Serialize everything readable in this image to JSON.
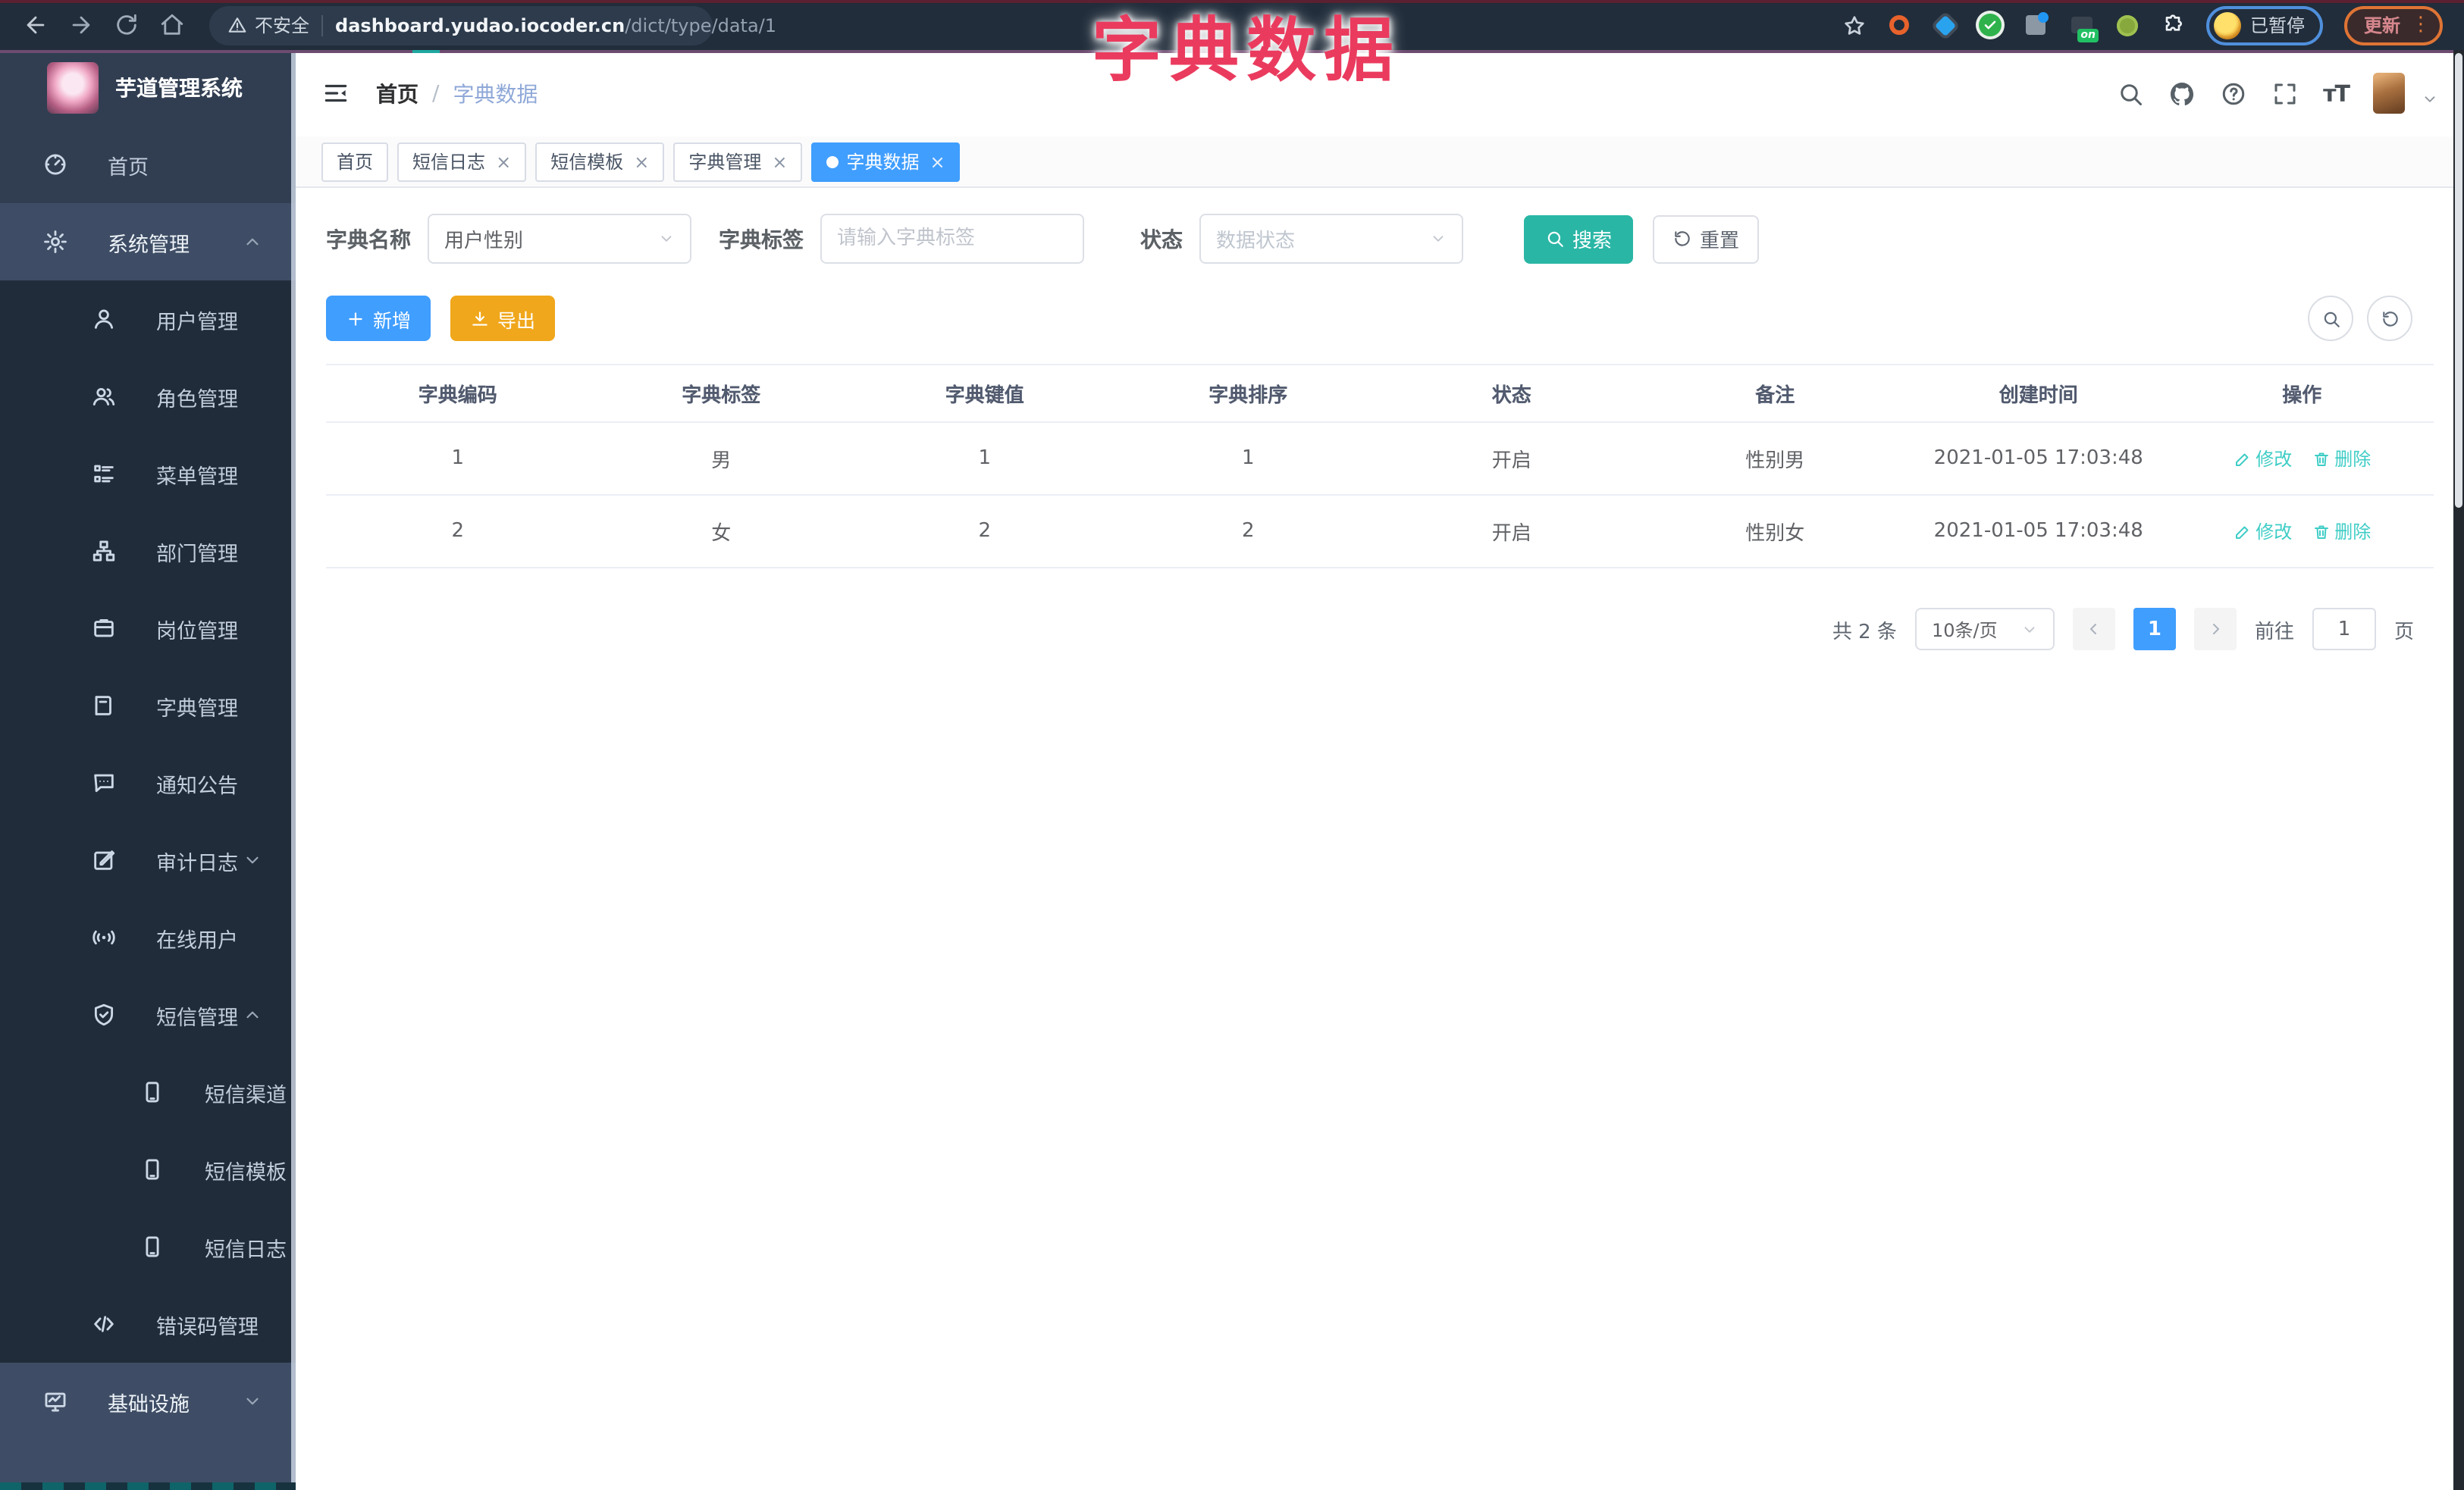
{
  "browser": {
    "security_label": "不安全",
    "url_host": "dashboard.yudao.iocoder.cn",
    "url_path": "/dict/type/data/1",
    "on_badge": "on",
    "paused_label": "已暂停",
    "update_label": "更新",
    "extension_icons": [
      "orange-ring-icon",
      "blue-kite-icon",
      "green-check-icon",
      "tune-icon",
      "on-badge-icon",
      "green-grid-icon",
      "puzzle-icon"
    ]
  },
  "overlay_title": "字典数据",
  "app_header": {
    "breadcrumb": {
      "root": "首页",
      "separator": "/",
      "current": "字典数据"
    }
  },
  "sidebar": {
    "logo_title": "芋道管理系统",
    "items": [
      {
        "id": "home",
        "label": "首页",
        "icon": "dashboard-icon",
        "level": 0
      },
      {
        "id": "system-mgmt",
        "label": "系统管理",
        "icon": "gear-icon",
        "level": 0,
        "chevron": "up",
        "highlight": true
      },
      {
        "id": "user-mgmt",
        "label": "用户管理",
        "icon": "user-icon",
        "level": 1
      },
      {
        "id": "role-mgmt",
        "label": "角色管理",
        "icon": "users-icon",
        "level": 1
      },
      {
        "id": "menu-mgmt",
        "label": "菜单管理",
        "icon": "menu-icon",
        "level": 1
      },
      {
        "id": "dept-mgmt",
        "label": "部门管理",
        "icon": "org-tree-icon",
        "level": 1
      },
      {
        "id": "post-mgmt",
        "label": "岗位管理",
        "icon": "badge-icon",
        "level": 1
      },
      {
        "id": "dict-mgmt",
        "label": "字典管理",
        "icon": "book-icon",
        "level": 1
      },
      {
        "id": "notice",
        "label": "通知公告",
        "icon": "message-icon",
        "level": 1
      },
      {
        "id": "audit-log",
        "label": "审计日志",
        "icon": "edit-square-icon",
        "level": 1,
        "chevron": "down"
      },
      {
        "id": "online-users",
        "label": "在线用户",
        "icon": "online-icon",
        "level": 1
      },
      {
        "id": "sms-mgmt",
        "label": "短信管理",
        "icon": "shield-check-icon",
        "level": 1,
        "chevron": "up"
      },
      {
        "id": "sms-channel",
        "label": "短信渠道",
        "icon": "phone-icon",
        "level": 2
      },
      {
        "id": "sms-template",
        "label": "短信模板",
        "icon": "phone-icon",
        "level": 2
      },
      {
        "id": "sms-log",
        "label": "短信日志",
        "icon": "phone-icon",
        "level": 2
      },
      {
        "id": "error-code-mgmt",
        "label": "错误码管理",
        "icon": "code-icon",
        "level": 1
      },
      {
        "id": "infrastructure",
        "label": "基础设施",
        "icon": "monitor-icon",
        "level": 0,
        "chevron": "down",
        "highlight": true
      }
    ]
  },
  "tabs": [
    {
      "id": "home",
      "label": "首页",
      "closable": false,
      "active": false
    },
    {
      "id": "sms-log",
      "label": "短信日志",
      "closable": true,
      "active": false
    },
    {
      "id": "sms-template",
      "label": "短信模板",
      "closable": true,
      "active": false
    },
    {
      "id": "dict-mgmt",
      "label": "字典管理",
      "closable": true,
      "active": false
    },
    {
      "id": "dict-data",
      "label": "字典数据",
      "closable": true,
      "active": true
    }
  ],
  "filters": {
    "dict_name": {
      "label": "字典名称",
      "value": "用户性别"
    },
    "dict_label": {
      "label": "字典标签",
      "placeholder": "请输入字典标签"
    },
    "status": {
      "label": "状态",
      "placeholder": "数据状态"
    },
    "search_label": "搜索",
    "reset_label": "重置"
  },
  "toolbar": {
    "add_label": "新增",
    "export_label": "导出"
  },
  "table": {
    "columns": [
      "字典编码",
      "字典标签",
      "字典键值",
      "字典排序",
      "状态",
      "备注",
      "创建时间",
      "操作"
    ],
    "action_labels": {
      "edit": "修改",
      "delete": "删除"
    },
    "rows": [
      {
        "code": "1",
        "label": "男",
        "value": "1",
        "sort": "1",
        "status": "开启",
        "remark": "性别男",
        "created": "2021-01-05 17:03:48"
      },
      {
        "code": "2",
        "label": "女",
        "value": "2",
        "sort": "2",
        "status": "开启",
        "remark": "性别女",
        "created": "2021-01-05 17:03:48"
      }
    ]
  },
  "pagination": {
    "total_text": "共 2 条",
    "page_size": "10条/页",
    "current_page": "1",
    "goto_label": "前往",
    "goto_value": "1",
    "page_label": "页"
  },
  "colors": {
    "primary": "#409eff",
    "teal_button": "#2ab6a5",
    "amber_button": "#f0a71b",
    "link_teal": "#3fcdc6",
    "annotation_red": "#ea3b5e"
  }
}
